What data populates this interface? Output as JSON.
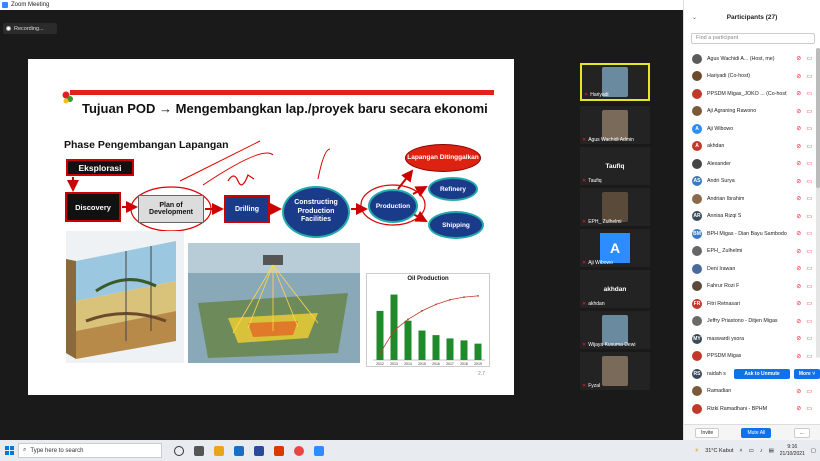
{
  "window": {
    "title": "Zoom Meeting",
    "minimize": "—",
    "maximize": "☐",
    "close": "✕"
  },
  "meeting": {
    "recording_label": "Recording..."
  },
  "slide": {
    "title": "Tujuan POD → Mengembangkan lap./proyek baru secara  ekonomi",
    "subtitle": "Phase Pengembangan Lapangan",
    "stages": {
      "eksplorasi": "Eksplorasi",
      "discovery": "Discovery",
      "plan": "Plan of Development",
      "drilling": "Drilling",
      "cpf": "Constructing Production Facilities",
      "production": "Production",
      "lapangan": "Lapangan Ditinggalkan",
      "refinery": "Refinery",
      "shipping": "Shipping"
    },
    "page_number": "2.7"
  },
  "chart_data": {
    "type": "bar",
    "title": "Oil Production",
    "categories": [
      "2012",
      "2013",
      "2014",
      "2015",
      "2016",
      "2017",
      "2018",
      "2019"
    ],
    "values": [
      75,
      100,
      60,
      45,
      38,
      33,
      30,
      25
    ],
    "cumulative": [
      10,
      45,
      62,
      75,
      85,
      92,
      96,
      98
    ],
    "ylim": [
      0,
      110
    ],
    "colors": {
      "bar": "#1f8a2a",
      "line": "#c0392b"
    }
  },
  "tiles": [
    {
      "name": "Hariyadi",
      "type": "image",
      "active": true
    },
    {
      "name": "Agus Wachidi Admin",
      "type": "image"
    },
    {
      "name": "Taufiq",
      "type": "text",
      "label": "Taufiq"
    },
    {
      "name": "EPH_ Zulhelmi",
      "type": "image"
    },
    {
      "name": "Aji Wibowo",
      "type": "avatar",
      "label": "A"
    },
    {
      "name": "akhdan",
      "type": "text",
      "label": "akhdan"
    },
    {
      "name": "Wijaya Kusuma Dewi",
      "type": "image"
    },
    {
      "name": "Fyzal",
      "type": "image"
    }
  ],
  "participants": {
    "header": "Participants (27)",
    "search_placeholder": "Find a participant",
    "unmute_label": "Ask to Unmute",
    "more_label": "More ˅",
    "invite_label": "Invite",
    "muteall_label": "Mute All",
    "more_footer": "...",
    "list": [
      {
        "name": "Agus Wachidi A... (Host, me)",
        "initials": "",
        "color": "#5b5b5b"
      },
      {
        "name": "Hariyadi (Co-host)",
        "initials": "",
        "color": "#6b4b2b"
      },
      {
        "name": "PPSDM Migas_JOKO ... (Co-host)",
        "initials": "",
        "color": "#c0392b"
      },
      {
        "name": "Aji Agraning Rawono",
        "initials": "",
        "color": "#7a5a3a"
      },
      {
        "name": "Aji Wibowo",
        "initials": "A",
        "color": "#2d8cff"
      },
      {
        "name": "akhdan",
        "initials": "A",
        "color": "#c0392b"
      },
      {
        "name": "Alexander",
        "initials": "",
        "color": "#444"
      },
      {
        "name": "Andri Surya",
        "initials": "AS",
        "color": "#3a7bbf"
      },
      {
        "name": "Andrian Ibrahim",
        "initials": "",
        "color": "#8a6a4a"
      },
      {
        "name": "Annisa Rizqi S",
        "initials": "AR",
        "color": "#3a4a5a"
      },
      {
        "name": "BPH Migas - Dian Bayu Sambodo",
        "initials": "BM",
        "color": "#3a7bbf"
      },
      {
        "name": "EPH_ Zulhelmi",
        "initials": "",
        "color": "#666"
      },
      {
        "name": "Deni Irawan",
        "initials": "",
        "color": "#4a6a9a"
      },
      {
        "name": "Fahrur Rozi F",
        "initials": "",
        "color": "#5a4a3a"
      },
      {
        "name": "Fitri Retnasari",
        "initials": "FR",
        "color": "#c0392b"
      },
      {
        "name": "Jeffry Priastono - Ditjen Migas",
        "initials": "",
        "color": "#6a6a6a"
      },
      {
        "name": "maswardi ysora",
        "initials": "MY",
        "color": "#3a4a5a"
      },
      {
        "name": "PPSDM Migas",
        "initials": "",
        "color": "#c0392b"
      },
      {
        "name": "raidah s",
        "initials": "RS",
        "color": "#3a4a5a"
      },
      {
        "name": "Ramadian",
        "initials": "",
        "color": "#7a5a3a"
      },
      {
        "name": "Rizki Ramadhani - BPHM",
        "initials": "",
        "color": "#c0392b"
      }
    ]
  },
  "taskbar": {
    "search_placeholder": "Type here to search",
    "weather": "31°C  Kabut",
    "time": "9:16",
    "date": "21/10/2021"
  }
}
